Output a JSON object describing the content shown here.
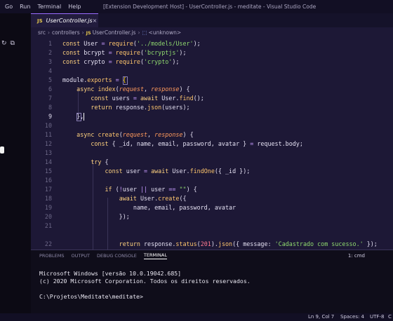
{
  "titlebar": {
    "menu": [
      "Go",
      "Run",
      "Terminal",
      "Help"
    ],
    "window_title": "[Extension Development Host] - UserController.js - meditate - Visual Studio Code"
  },
  "tab": {
    "filename": "UserController.js",
    "icon_label": "JS",
    "close_label": "×"
  },
  "breadcrumb": {
    "folder1": "src",
    "folder2": "controllers",
    "file": "UserController.js",
    "symbol": "<unknown>"
  },
  "code": {
    "numbers": [
      "1",
      "2",
      "3",
      "4",
      "5",
      "6",
      "7",
      "8",
      "9",
      "10",
      "11",
      "12",
      "13",
      "14",
      "15",
      "16",
      "17",
      "18",
      "19",
      "20",
      "21",
      "22"
    ]
  },
  "panel": {
    "tabs": [
      "PROBLEMS",
      "OUTPUT",
      "DEBUG CONSOLE",
      "TERMINAL"
    ],
    "active_tab": "TERMINAL",
    "terminal_select": "1: cmd"
  },
  "terminal": {
    "lines": [
      "Microsoft Windows [versão 10.0.19042.685]",
      "(c) 2020 Microsoft Corporation. Todos os direitos reservados.",
      "",
      "C:\\Projetos\\Meditate\\meditate>"
    ]
  },
  "statusbar": {
    "position": "Ln 9, Col 7",
    "spaces": "Spaces: 4",
    "encoding": "UTF-8",
    "eol": "C"
  },
  "colors": {
    "accent": "#9b6bff",
    "background": "#1d1836",
    "string": "#8fd96e",
    "keyword": "#ffd27f"
  }
}
